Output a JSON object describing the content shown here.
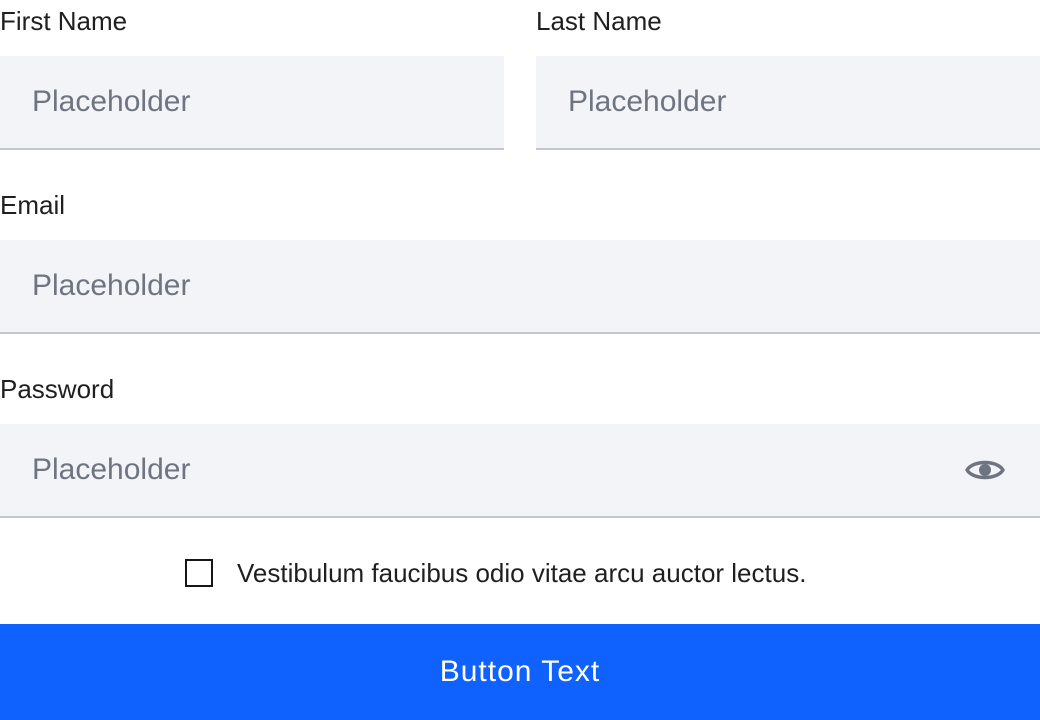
{
  "form": {
    "first_name": {
      "label": "First Name",
      "placeholder": "Placeholder",
      "value": ""
    },
    "last_name": {
      "label": "Last Name",
      "placeholder": "Placeholder",
      "value": ""
    },
    "email": {
      "label": "Email",
      "placeholder": "Placeholder",
      "value": ""
    },
    "password": {
      "label": "Password",
      "placeholder": "Placeholder",
      "value": "",
      "icon": "eye-icon"
    },
    "agreement": {
      "text": "Vestibulum faucibus odio vitae arcu auctor lectus.",
      "checked": false
    },
    "submit": {
      "label": "Button Text"
    }
  },
  "colors": {
    "primary": "#0f62fe",
    "field_background": "#f2f4f8",
    "field_border": "#c1c7cd",
    "placeholder": "#6f7580",
    "text": "#161616"
  }
}
